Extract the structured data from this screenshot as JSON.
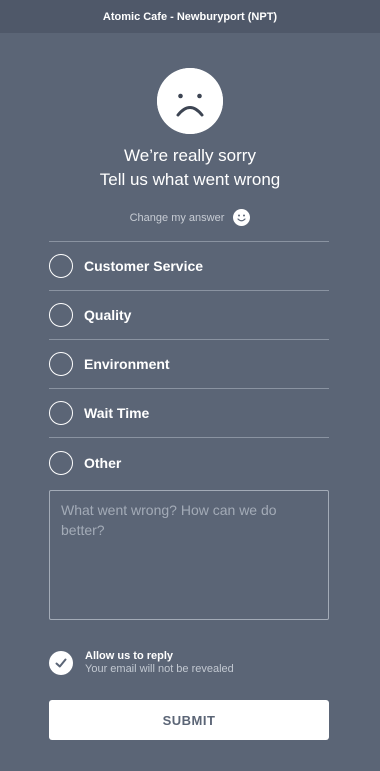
{
  "header": {
    "title": "Atomic Cafe - Newburyport (NPT)"
  },
  "feedback_face": {
    "icon": "sad-face-icon"
  },
  "headline": {
    "line1": "We’re really sorry",
    "line2": "Tell us what went wrong"
  },
  "change_answer": {
    "label": "Change my answer",
    "icon": "smile-face-icon"
  },
  "options": [
    {
      "label": "Customer Service"
    },
    {
      "label": "Quality"
    },
    {
      "label": "Environment"
    },
    {
      "label": "Wait Time"
    },
    {
      "label": "Other"
    }
  ],
  "feedback_input": {
    "placeholder": "What went wrong? How can we do better?",
    "value": ""
  },
  "reply": {
    "checked": true,
    "label": "Allow us to reply",
    "sublabel": "Your email will not be revealed"
  },
  "submit": {
    "label": "SUBMIT"
  },
  "colors": {
    "background": "#5b6576",
    "header": "#4f5869",
    "divider": "#8a93a1",
    "white": "#ffffff"
  }
}
